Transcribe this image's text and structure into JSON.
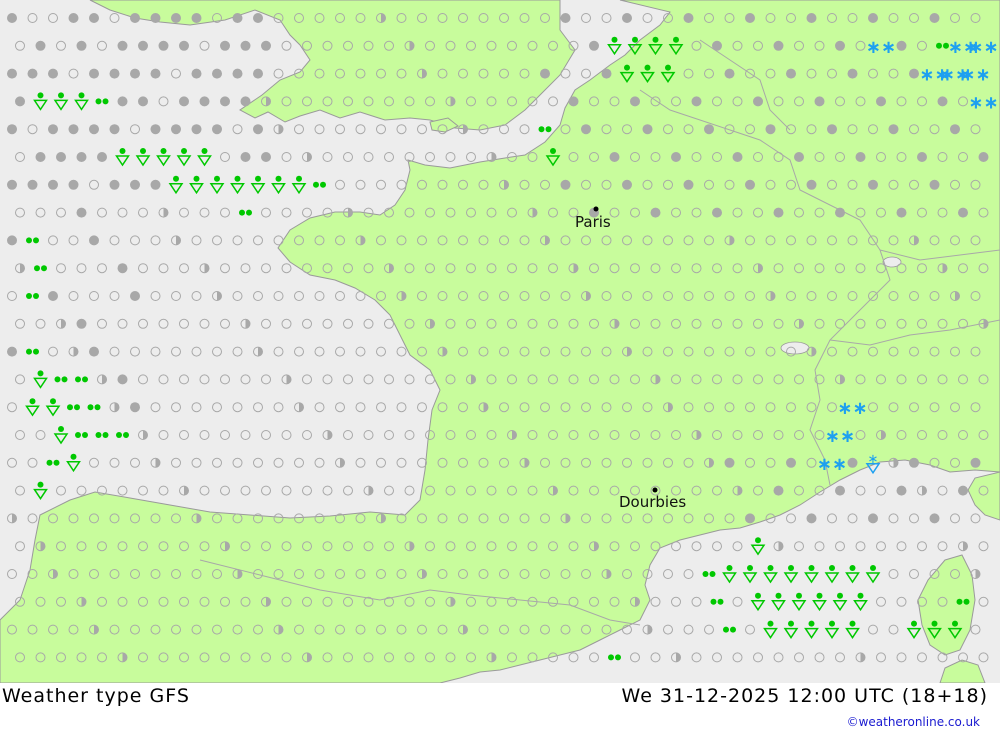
{
  "map": {
    "cities": [
      {
        "id": "paris",
        "name": "Paris"
      },
      {
        "id": "dourbies",
        "name": "Dourbies"
      }
    ],
    "colors": {
      "sea": "#ededed",
      "land": "#c8fc9c",
      "border": "#a0a0a0",
      "overcast_symbol": "#a8a8a8",
      "rain_symbol": "#00c800",
      "snow_symbol": "#1ea0f0"
    },
    "symbol_legend": [
      "clear",
      "partly-cloudy",
      "overcast",
      "drizzle",
      "rain-shower",
      "snow",
      "snow-shower"
    ]
  },
  "footer": {
    "title": "Weather type  GFS",
    "valid_time": "We 31-12-2025 12:00 UTC (18+18)",
    "credit": "©weatheronline.co.uk"
  }
}
